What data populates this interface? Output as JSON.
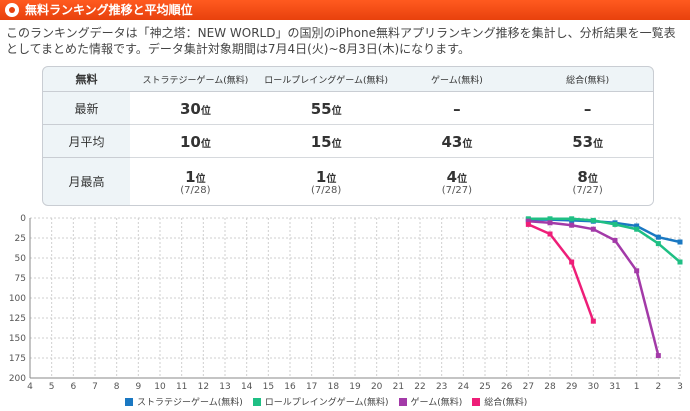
{
  "header": {
    "title": "無料ランキング推移と平均順位"
  },
  "description": "このランキングデータは「神之塔：NEW WORLD」の国別のiPhone無料アプリランキング推移を集計し、分析結果を一覧表としてまとめた情報です。データ集計対象期間は7月4日(火)~8月3日(木)になります。",
  "table": {
    "corner": "無料",
    "columns": [
      "ストラテジーゲーム(無料)",
      "ロールプレイングゲーム(無料)",
      "ゲーム(無料)",
      "総合(無料)"
    ],
    "rows": [
      {
        "label": "最新",
        "cells": [
          {
            "value": "30",
            "unit": "位"
          },
          {
            "value": "55",
            "unit": "位"
          },
          {
            "value": "–",
            "unit": ""
          },
          {
            "value": "–",
            "unit": ""
          }
        ]
      },
      {
        "label": "月平均",
        "cells": [
          {
            "value": "10",
            "unit": "位"
          },
          {
            "value": "15",
            "unit": "位"
          },
          {
            "value": "43",
            "unit": "位"
          },
          {
            "value": "53",
            "unit": "位"
          }
        ]
      },
      {
        "label": "月最高",
        "cells": [
          {
            "value": "1",
            "unit": "位",
            "date": "(7/28)"
          },
          {
            "value": "1",
            "unit": "位",
            "date": "(7/28)"
          },
          {
            "value": "4",
            "unit": "位",
            "date": "(7/27)"
          },
          {
            "value": "8",
            "unit": "位",
            "date": "(7/27)"
          }
        ]
      }
    ]
  },
  "chart_data": {
    "type": "line",
    "x": [
      "4",
      "5",
      "6",
      "7",
      "8",
      "9",
      "10",
      "11",
      "12",
      "13",
      "14",
      "15",
      "16",
      "17",
      "18",
      "19",
      "20",
      "21",
      "22",
      "23",
      "24",
      "25",
      "26",
      "27",
      "28",
      "29",
      "30",
      "31",
      "1",
      "2",
      "3"
    ],
    "ylim": [
      0,
      200
    ],
    "y_inverted": true,
    "yticks": [
      0,
      25,
      50,
      75,
      100,
      125,
      150,
      175,
      200
    ],
    "grid": true,
    "legend_position": "bottom",
    "series": [
      {
        "name": "ストラテジーゲーム(無料)",
        "color": "#1a78c2",
        "points": [
          [
            "27",
            2
          ],
          [
            "28",
            2
          ],
          [
            "29",
            3
          ],
          [
            "30",
            4
          ],
          [
            "31",
            6
          ],
          [
            "1",
            10
          ],
          [
            "2",
            24
          ],
          [
            "3",
            30
          ]
        ]
      },
      {
        "name": "ロールプレイングゲーム(無料)",
        "color": "#1fbf84",
        "points": [
          [
            "27",
            1
          ],
          [
            "28",
            1
          ],
          [
            "29",
            1
          ],
          [
            "30",
            3
          ],
          [
            "31",
            8
          ],
          [
            "1",
            14
          ],
          [
            "2",
            32
          ],
          [
            "3",
            55
          ]
        ]
      },
      {
        "name": "ゲーム(無料)",
        "color": "#a33aa8",
        "points": [
          [
            "27",
            4
          ],
          [
            "28",
            6
          ],
          [
            "29",
            9
          ],
          [
            "30",
            14
          ],
          [
            "31",
            28
          ],
          [
            "1",
            66
          ],
          [
            "2",
            172
          ]
        ]
      },
      {
        "name": "総合(無料)",
        "color": "#ee1e78",
        "points": [
          [
            "27",
            8
          ],
          [
            "28",
            20
          ],
          [
            "29",
            55
          ],
          [
            "30",
            129
          ]
        ]
      }
    ]
  }
}
